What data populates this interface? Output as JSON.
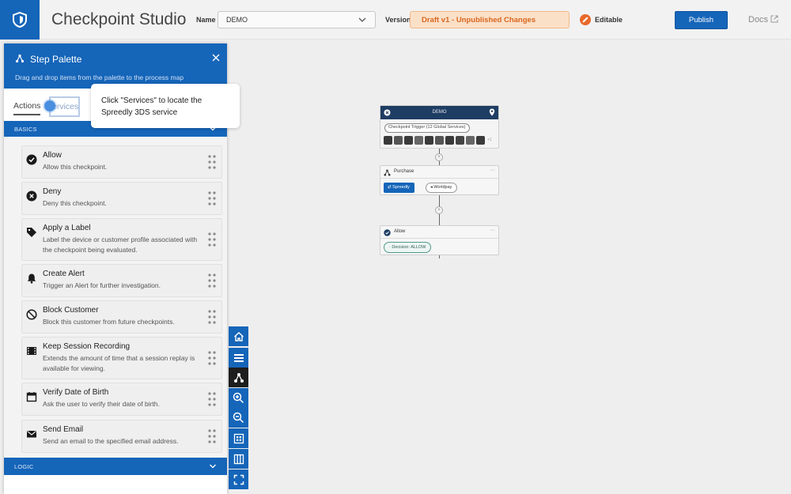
{
  "header": {
    "app_title": "Checkpoint Studio",
    "name_label": "Name",
    "name_value": "DEMO",
    "version_label": "Version",
    "version_value": "Draft v1 - Unpublished Changes",
    "editable_label": "Editable",
    "publish_label": "Publish",
    "docs_label": "Docs"
  },
  "palette": {
    "title": "Step Palette",
    "subtitle": "Drag and drop items from the palette to the process map",
    "tabs": [
      {
        "label": "Actions"
      },
      {
        "label": "Services",
        "visible_text": "ervices"
      }
    ],
    "sections": [
      {
        "label": "BASICS"
      },
      {
        "label": "LOGIC"
      }
    ],
    "items": [
      {
        "title": "Allow",
        "desc": "Allow this checkpoint.",
        "icon": "check-circle-icon"
      },
      {
        "title": "Deny",
        "desc": "Deny this checkpoint.",
        "icon": "x-circle-icon"
      },
      {
        "title": "Apply a Label",
        "desc": "Label the device or customer profile associated with the checkpoint being evaluated.",
        "icon": "tag-icon"
      },
      {
        "title": "Create Alert",
        "desc": "Trigger an Alert for further investigation.",
        "icon": "bell-icon"
      },
      {
        "title": "Block Customer",
        "desc": "Block this customer from future checkpoints.",
        "icon": "block-icon"
      },
      {
        "title": "Keep Session Recording",
        "desc": "Extends the amount of time that a session replay is available for viewing.",
        "icon": "film-icon"
      },
      {
        "title": "Verify Date of Birth",
        "desc": "Ask the user to verify their date of birth.",
        "icon": "calendar-icon"
      },
      {
        "title": "Send Email",
        "desc": "Send an email to the specified email address.",
        "icon": "envelope-icon"
      }
    ]
  },
  "tooltip": {
    "text": "Click \"Services\" to locate the Spreedly 3DS service"
  },
  "toolbar": {
    "tools": [
      "home-icon",
      "list-icon",
      "flow-icon",
      "zoom-in-icon",
      "zoom-out-icon",
      "grid-icon",
      "columns-icon",
      "fullscreen-icon"
    ],
    "active": "flow-icon"
  },
  "flow": {
    "trigger_title": "DEMO",
    "trigger_pill": "Checkpoint Trigger (12 Global Services)",
    "trigger_more": "+1",
    "purchase_title": "Purchase",
    "purchase_services": [
      "Spreedly",
      "Worldpay"
    ],
    "allow_title": "Allow",
    "decision_label": "Decision: ALLOW"
  },
  "colors": {
    "brand_blue": "#1565b9",
    "header_bg": "#f2f2f2",
    "draft_orange": "#d9661f",
    "draft_bg": "#fbe0c8",
    "canvas_bg": "#eeeeee"
  }
}
